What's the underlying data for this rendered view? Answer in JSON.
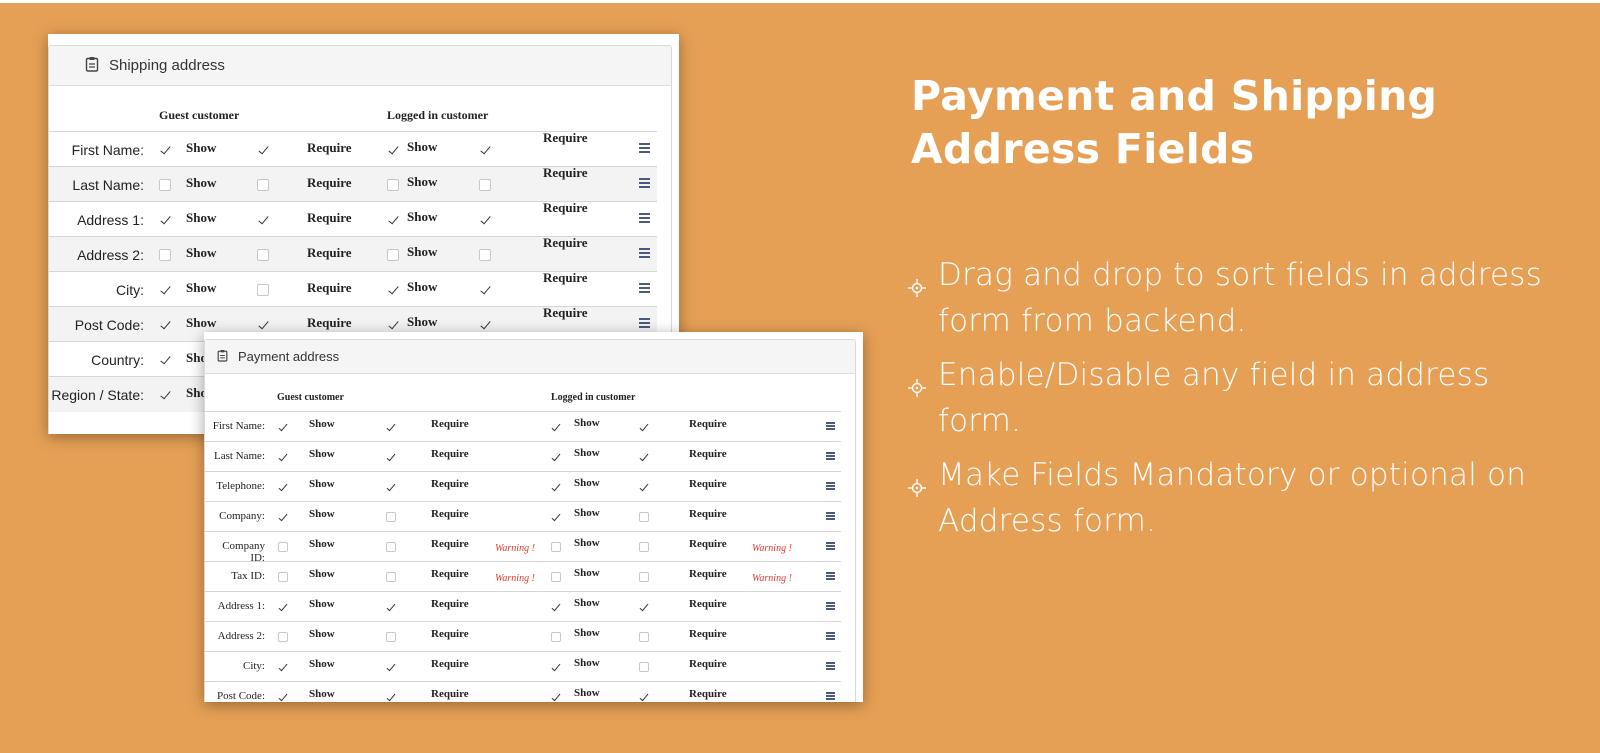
{
  "shipping": {
    "title": "Shipping address",
    "guest_header": "Guest customer",
    "logged_header": "Logged in customer",
    "show_label": "Show",
    "require_label": "Require",
    "rows": [
      {
        "label": "First Name:",
        "g_show": true,
        "g_req": true,
        "l_show": true,
        "l_req": true
      },
      {
        "label": "Last Name:",
        "g_show": false,
        "g_req": false,
        "l_show": false,
        "l_req": false
      },
      {
        "label": "Address 1:",
        "g_show": true,
        "g_req": true,
        "l_show": true,
        "l_req": true
      },
      {
        "label": "Address 2:",
        "g_show": false,
        "g_req": false,
        "l_show": false,
        "l_req": false
      },
      {
        "label": "City:",
        "g_show": true,
        "g_req": false,
        "l_show": true,
        "l_req": true
      },
      {
        "label": "Post Code:",
        "g_show": true,
        "g_req": true,
        "l_show": true,
        "l_req": true
      },
      {
        "label": "Country:",
        "g_show": true,
        "g_req": true,
        "l_show": true,
        "l_req": true
      },
      {
        "label": "Region / State:",
        "g_show": true,
        "g_req": true,
        "l_show": true,
        "l_req": true
      }
    ]
  },
  "payment": {
    "title": "Payment address",
    "guest_header": "Guest customer",
    "logged_header": "Logged in customer",
    "show_label": "Show",
    "require_label": "Require",
    "warning_label": "Warning !",
    "rows": [
      {
        "label": "First Name:",
        "g_show": true,
        "g_req": true,
        "l_show": true,
        "l_req": true,
        "warn": false
      },
      {
        "label": "Last Name:",
        "g_show": true,
        "g_req": true,
        "l_show": true,
        "l_req": true,
        "warn": false
      },
      {
        "label": "Telephone:",
        "g_show": true,
        "g_req": true,
        "l_show": true,
        "l_req": true,
        "warn": false
      },
      {
        "label": "Company:",
        "g_show": true,
        "g_req": false,
        "l_show": true,
        "l_req": false,
        "warn": false
      },
      {
        "label": "Company ID:",
        "g_show": false,
        "g_req": false,
        "l_show": false,
        "l_req": false,
        "warn": true
      },
      {
        "label": "Tax ID:",
        "g_show": false,
        "g_req": false,
        "l_show": false,
        "l_req": false,
        "warn": true
      },
      {
        "label": "Address 1:",
        "g_show": true,
        "g_req": true,
        "l_show": true,
        "l_req": true,
        "warn": false
      },
      {
        "label": "Address 2:",
        "g_show": false,
        "g_req": false,
        "l_show": false,
        "l_req": false,
        "warn": false
      },
      {
        "label": "City:",
        "g_show": true,
        "g_req": true,
        "l_show": true,
        "l_req": false,
        "warn": false
      },
      {
        "label": "Post Code:",
        "g_show": true,
        "g_req": true,
        "l_show": true,
        "l_req": true,
        "warn": false
      }
    ]
  },
  "feature": {
    "headline": "Payment and Shipping Address Fields",
    "bullets": [
      "Drag and drop to sort fields in address form from backend.",
      "Enable/Disable any field in address form.",
      "Make Fields Mandatory or optional on Address form."
    ]
  },
  "colors": {
    "background": "#e5a055",
    "text": "#ffffff",
    "warning": "#e53935",
    "drag_handle": "#4b5a7a"
  }
}
